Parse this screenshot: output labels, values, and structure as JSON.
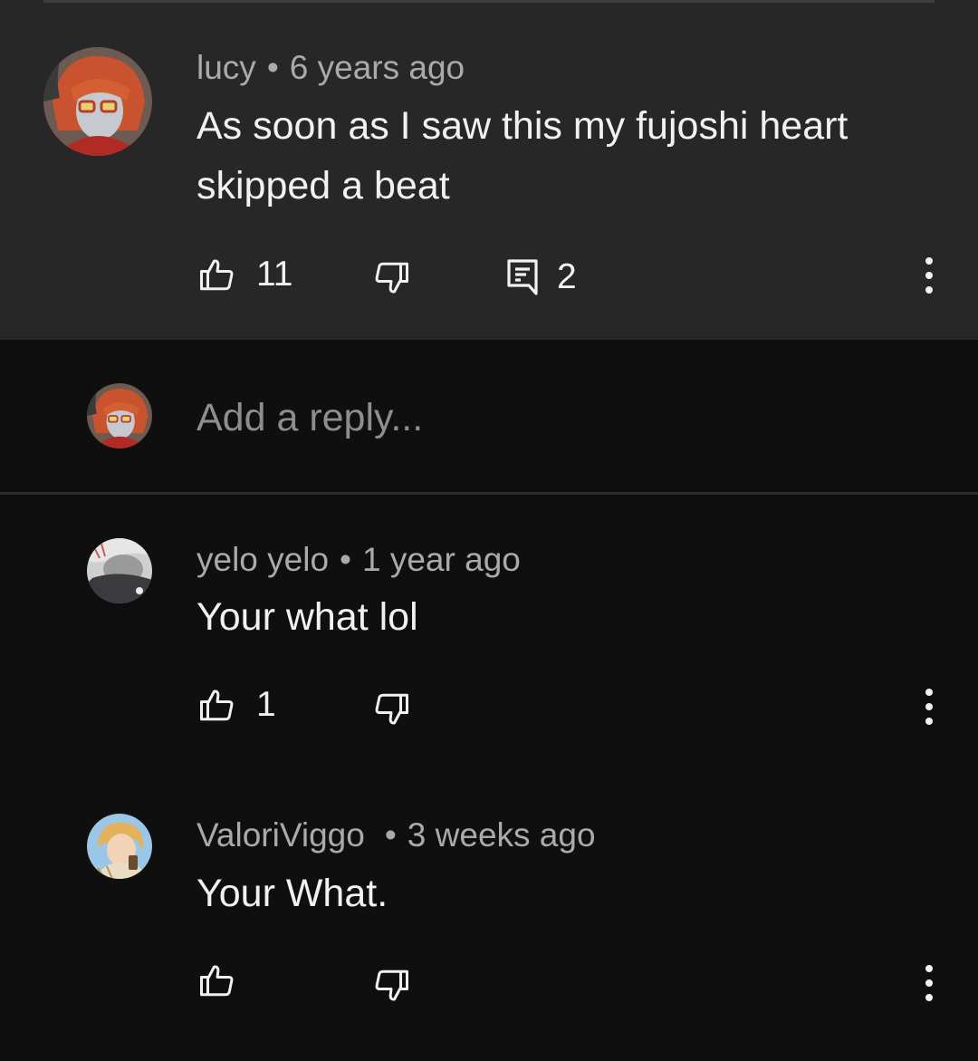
{
  "parent_comment": {
    "author": "lucy",
    "separator": "•",
    "time": "6 years ago",
    "text": "As soon as I saw this my fujoshi heart skipped a beat",
    "likes": "11",
    "replies": "2",
    "icons": [
      "thumb-up-icon",
      "thumb-down-icon",
      "reply-comment-icon",
      "more-vert-icon"
    ]
  },
  "reply_input": {
    "placeholder": "Add a reply..."
  },
  "replies": [
    {
      "author": "yelo yelo",
      "separator": "•",
      "time": "1 year ago",
      "text": "Your what lol",
      "likes": "1"
    },
    {
      "author": "ValoriViggo",
      "separator": "•",
      "time": "3 weeks ago",
      "text": "Your What.",
      "likes": ""
    }
  ],
  "colors": {
    "parent_background": "#272727",
    "page_background": "#0f0f0f",
    "text_primary": "#f1f1f1",
    "text_secondary": "#aaaaaa"
  }
}
